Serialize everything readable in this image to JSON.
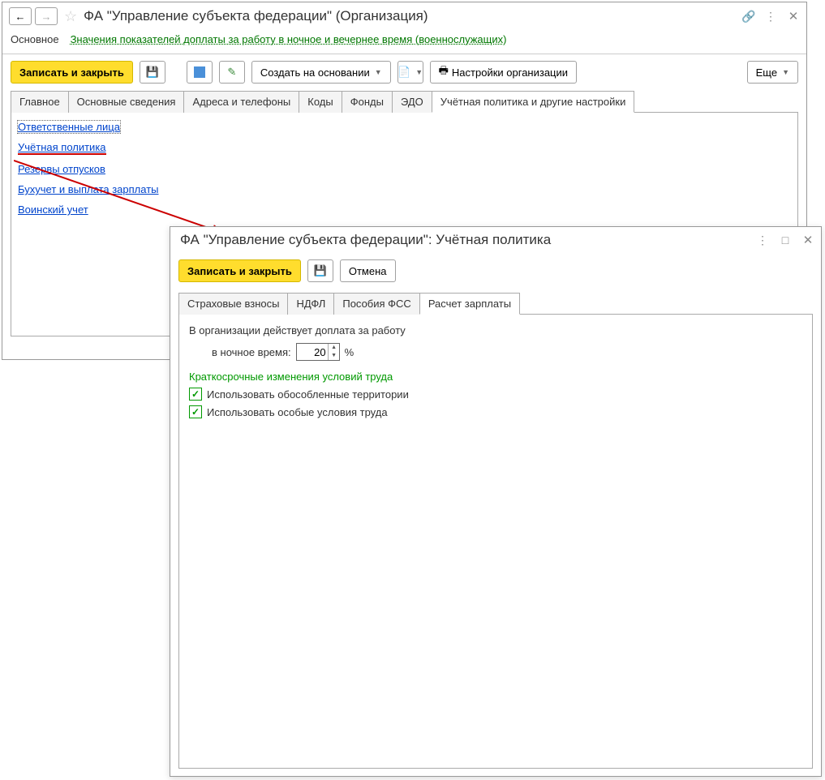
{
  "mainWindow": {
    "title": "ФА \"Управление субъекта федерации\" (Организация)",
    "nav": {
      "main": "Основное",
      "link": "Значения показателей доплаты за работу в ночное и вечернее время (военнослужащих)"
    },
    "toolbar": {
      "saveClose": "Записать и закрыть",
      "createBased": "Создать на основании",
      "orgSettings": "Настройки организации",
      "more": "Еще"
    },
    "tabs": [
      "Главное",
      "Основные сведения",
      "Адреса и телефоны",
      "Коды",
      "Фонды",
      "ЭДО",
      "Учётная политика и другие настройки"
    ],
    "activeTab": "Учётная политика и другие настройки",
    "links": {
      "responsible": "Ответственные лица",
      "accPolicy": "Учётная политика",
      "vacReserves": "Резервы отпусков",
      "accounting": "Бухучет и выплата зарплаты",
      "military": "Воинский учет"
    }
  },
  "subWindow": {
    "title": "ФА \"Управление субъекта федерации\": Учётная политика",
    "toolbar": {
      "saveClose": "Записать и закрыть",
      "cancel": "Отмена"
    },
    "tabs": [
      "Страховые взносы",
      "НДФЛ",
      "Пособия ФСС",
      "Расчет зарплаты"
    ],
    "activeTab": "Расчет зарплаты",
    "form": {
      "heading": "В организации действует доплата за работу",
      "nightLabel": "в ночное время:",
      "nightValue": "20",
      "percent": "%",
      "sectionTitle": "Краткосрочные изменения условий труда",
      "chk1": "Использовать обособленные территории",
      "chk2": "Использовать особые условия труда"
    }
  }
}
